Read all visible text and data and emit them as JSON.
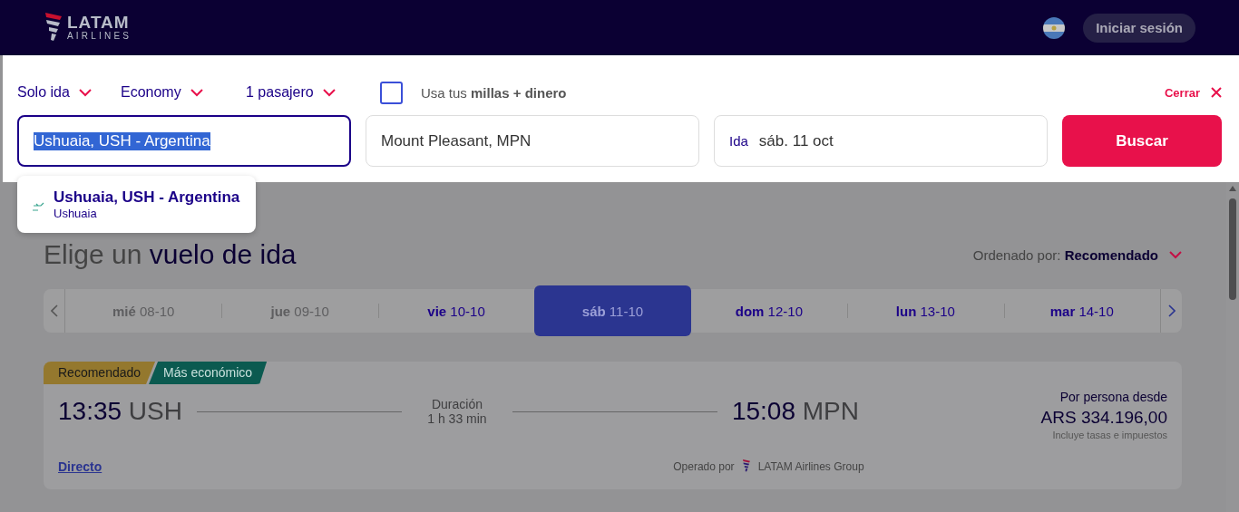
{
  "header": {
    "logo": {
      "line1": "LATAM",
      "line2": "AIRLINES"
    },
    "login_button": "Iniciar sesión"
  },
  "search": {
    "options": [
      {
        "label": "Solo ida"
      },
      {
        "label": "Economy"
      },
      {
        "label": "1 pasajero"
      }
    ],
    "miles": {
      "label": "Usa tus **millas + dinero**",
      "checked": false
    },
    "close": "Cerrar",
    "origin": {
      "value": "Ushuaia, USH - Argentina",
      "text_selected": true
    },
    "destination": {
      "value": "Mount Pleasant, MPN"
    },
    "date": {
      "label": "Ida",
      "value": "sáb. 11 oct"
    },
    "button": "Buscar"
  },
  "suggestions": [
    {
      "title": "Ushuaia, USH - Argentina",
      "subtitle": "Ushuaia"
    }
  ],
  "results": {
    "heading": "Elige un **vuelo de ida**",
    "sort": {
      "label": "Ordenado por:",
      "value": "Recomendado"
    },
    "dates": [
      {
        "day": "mié",
        "date": "08-10",
        "selected": false,
        "disabled": true
      },
      {
        "day": "jue",
        "date": "09-10",
        "selected": false,
        "disabled": true
      },
      {
        "day": "vie",
        "date": "10-10",
        "selected": false,
        "disabled": false
      },
      {
        "day": "sáb",
        "date": "11-10",
        "selected": true,
        "disabled": false
      },
      {
        "day": "dom",
        "date": "12-10",
        "selected": false,
        "disabled": false
      },
      {
        "day": "lun",
        "date": "13-10",
        "selected": false,
        "disabled": false
      },
      {
        "day": "mar",
        "date": "14-10",
        "selected": false,
        "disabled": false
      }
    ],
    "flight": {
      "tags": [
        {
          "label": "Recomendado",
          "color": "#94782e"
        },
        {
          "label": "Más económico",
          "color": "#0b5a50"
        }
      ],
      "departure": {
        "time": "13:35",
        "code": "USH"
      },
      "duration": {
        "label": "Duración",
        "value": "1 h 33 min"
      },
      "arrival": {
        "time": "15:08",
        "code": "MPN"
      },
      "price": {
        "label": "Por persona desde",
        "amount": "ARS 334.196,00",
        "note": "Incluye tasas e impuestos"
      },
      "stops": "Directo",
      "operated": {
        "label": "Operado por",
        "airline": "LATAM Airlines Group"
      }
    }
  }
}
